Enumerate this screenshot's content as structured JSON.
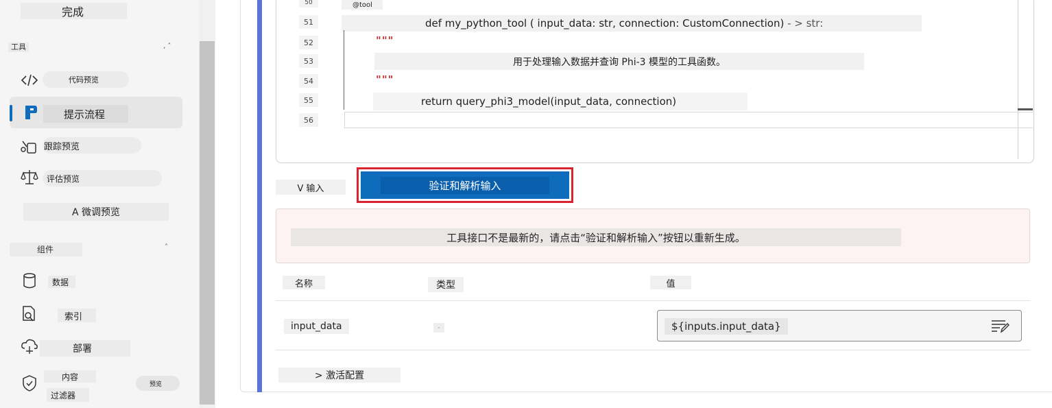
{
  "sidebar": {
    "done_label": "完成",
    "tools_section": "工具",
    "tools_caret": "˄",
    "items": [
      {
        "label": "代码预览",
        "icon": "code-icon"
      },
      {
        "label": "提示流程",
        "icon": "prompt-flow-icon"
      },
      {
        "label": "跟踪预览",
        "icon": "tracing-icon"
      },
      {
        "label": "评估预览",
        "icon": "scale-icon"
      },
      {
        "label": "A 微调预览",
        "icon": "fine-tune-icon"
      }
    ],
    "components_section": "组件",
    "components_caret": "˄",
    "components": [
      {
        "label": "数据",
        "icon": "database-icon"
      },
      {
        "label": "索引",
        "icon": "index-search-icon"
      },
      {
        "label": "部署",
        "icon": "cloud-deploy-icon"
      },
      {
        "label_line1": "内容",
        "label_line2": "过滤器",
        "badge": "预览",
        "icon": "shield-icon"
      }
    ]
  },
  "editor": {
    "lines": [
      {
        "num": "50",
        "text": "@tool"
      },
      {
        "num": "51",
        "text": "def my_python_tool ( input_data: str, connection: CustomConnection)",
        "suffix": " - > str:"
      },
      {
        "num": "52",
        "text": "\"\"\""
      },
      {
        "num": "53",
        "text": "用于处理输入数据并查询 Phi-3 模型的工具函数。"
      },
      {
        "num": "54",
        "text": "\"\"\""
      },
      {
        "num": "55",
        "text": "return query_phi3_model(input_data, connection)"
      },
      {
        "num": "56",
        "text": ""
      }
    ]
  },
  "inputs": {
    "toggle_label": "V 输入",
    "validate_button": "验证和解析输入",
    "warning": "工具接口不是最新的，请点击“验证和解析输入”按钮以重新生成。",
    "columns": {
      "name": "名称",
      "type": "类型",
      "value": "值"
    },
    "rows": [
      {
        "name": "input_data",
        "type": "-",
        "value": "${inputs.input_data}"
      }
    ]
  },
  "activate_config": "> 激活配置",
  "colors": {
    "accent": "#0f6cbd",
    "highlight_outline": "#d9232e",
    "accent_line": "#5b74d8",
    "warning_bg": "#fdf3f4",
    "docstring": "#c5312f"
  }
}
